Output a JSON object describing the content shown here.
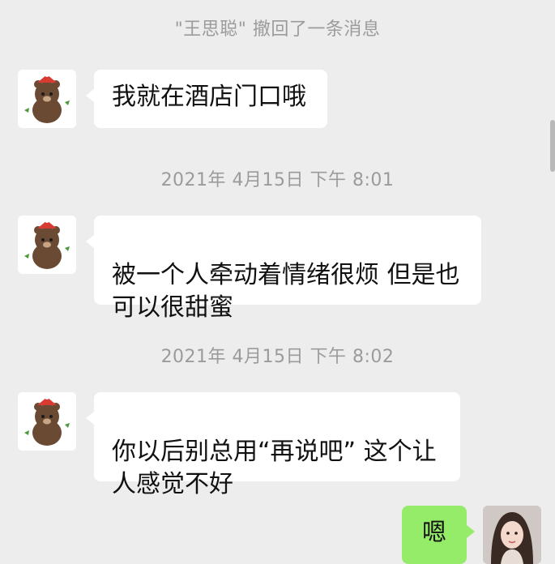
{
  "chat": {
    "recall_notice": "\"王思聪\" 撤回了一条消息",
    "messages": [
      {
        "text": "我就在酒店门口哦"
      },
      {
        "text": "被一个人牵动着情绪很烦 但是也\n可以很甜蜜"
      },
      {
        "text": "你以后别总用“再说吧” 这个让\n人感觉不好"
      },
      {
        "text": "嗯"
      }
    ],
    "timestamps": [
      "2021年 4月15日 下午 8:01",
      "2021年 4月15日 下午 8:02"
    ]
  },
  "colors": {
    "background": "#ededed",
    "incoming_bubble": "#ffffff",
    "outgoing_bubble": "#95ec69",
    "system_text": "#9b9b9b"
  },
  "icons": {
    "contact_avatar": "bear-avatar-icon",
    "self_avatar": "girl-avatar-icon"
  }
}
